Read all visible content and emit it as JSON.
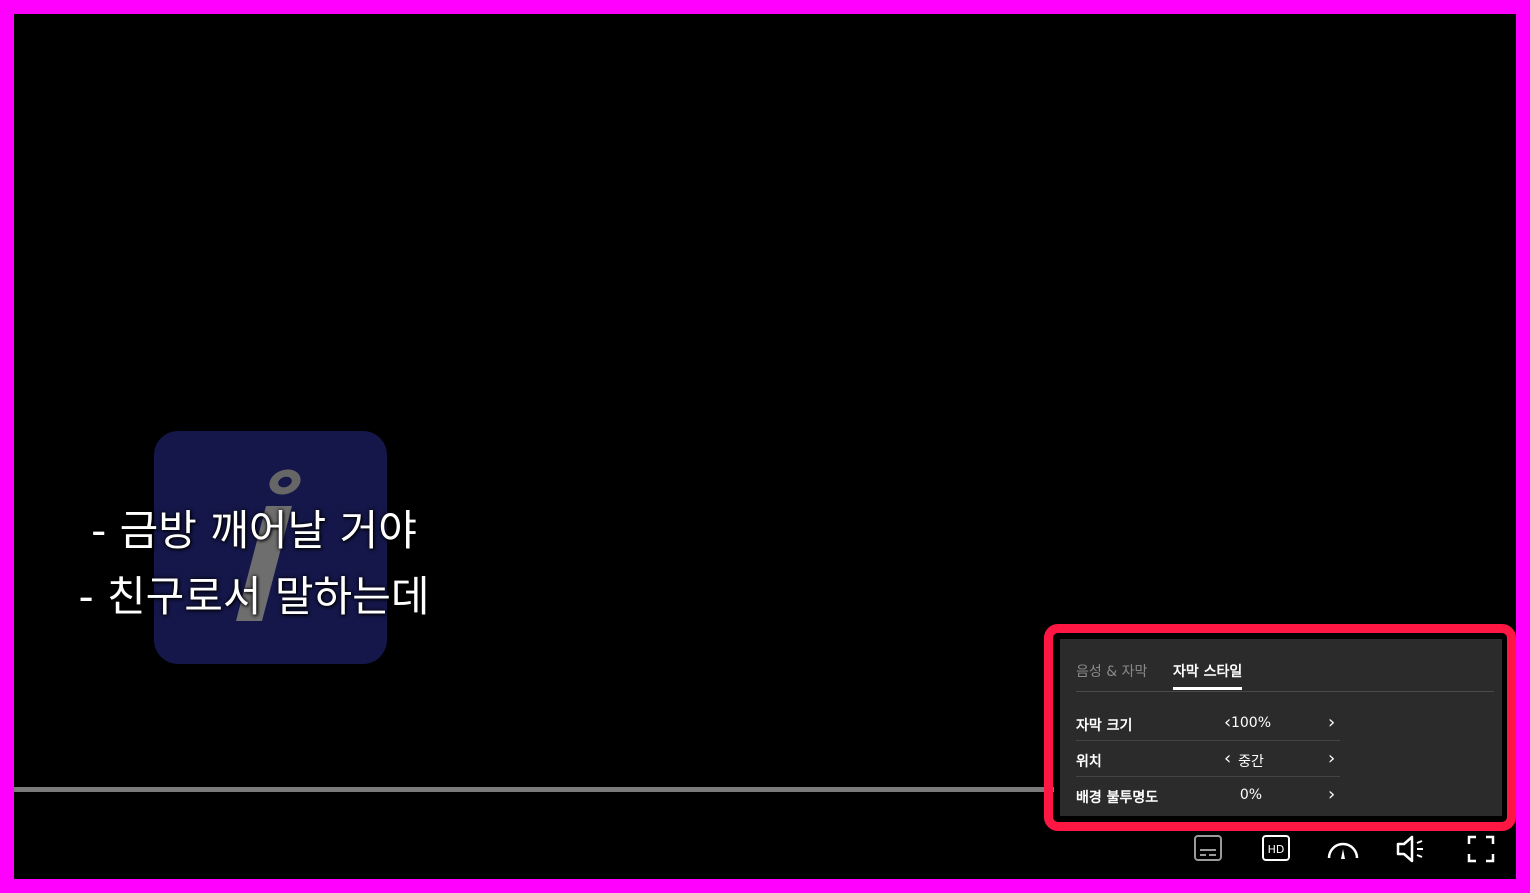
{
  "subtitles": {
    "line1": "- 금방 깨어날 거야",
    "line2": "- 친구로서 말하는데"
  },
  "settings_panel": {
    "tabs": [
      "음성 & 자막",
      "자막 스타일"
    ],
    "active_tab": "자막 스타일",
    "rows": [
      {
        "label": "자막 크기",
        "value": "100%",
        "prev": "‹",
        "next": "›"
      },
      {
        "label": "위치",
        "value": "중간",
        "prev": "‹",
        "next": "›"
      },
      {
        "label": "배경 불투명도",
        "value": "0%",
        "next": "›"
      }
    ]
  },
  "controls": {
    "icons": [
      "subtitles-icon",
      "hd-icon",
      "speed-icon",
      "volume-icon",
      "fullscreen-icon"
    ],
    "hd_label": "HD"
  },
  "colors": {
    "frame": "#ff00ff",
    "highlight": "#ff1744",
    "panel_bg": "#2b2b2b",
    "logo_bg": "#15174a"
  }
}
